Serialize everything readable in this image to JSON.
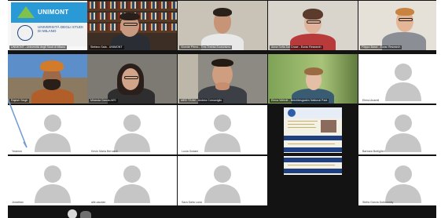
{
  "meeting": {
    "participants": [
      {
        "tile": "logo",
        "name": "UNIMONT - Università degli Studi di Milano"
      },
      {
        "tile": "video",
        "name": "Stefano Sala - UNIMONT"
      },
      {
        "tile": "video",
        "name": "Vicente Pérez - Tres Treinta Ecoturismo"
      },
      {
        "tile": "video",
        "name": "Anna Sofia Dal Croce - Eurac Research"
      },
      {
        "tile": "video",
        "name": "Filippo Bassi - Eurac Research"
      },
      {
        "tile": "video",
        "name": "Rajesh Singh"
      },
      {
        "tile": "video",
        "name": "Miranda Garcia AES"
      },
      {
        "tile": "video",
        "name": "MEB TEAM - Andrea Cornaviglio"
      },
      {
        "tile": "video",
        "name": "Elena Wehrle - Berchtesgaden National Park"
      },
      {
        "tile": "avatar",
        "name": "Elena Anaridi"
      },
      {
        "tile": "avatar",
        "name": "Yeamon"
      },
      {
        "tile": "avatar",
        "name": "Kevin Maria Bernardi"
      },
      {
        "tile": "avatar",
        "name": "Lucia Godani"
      },
      {
        "tile": "avatar",
        "name": "Julian Mentag"
      },
      {
        "tile": "document",
        "name": ""
      },
      {
        "tile": "avatar",
        "name": "Barbara Bottiglieri"
      },
      {
        "tile": "avatar",
        "name": "Jonathan"
      },
      {
        "tile": "avatar",
        "name": "alle.caudan"
      },
      {
        "tile": "avatar",
        "name": "Sara Dalla Lana"
      },
      {
        "tile": "avatar",
        "name": "Daniele Bassanini"
      },
      {
        "tile": "document",
        "name": ""
      },
      {
        "tile": "avatar",
        "name": "Stella Garcia Dubrowsky"
      }
    ]
  },
  "logo": {
    "brand": "UNIMONT",
    "university": "UNIVERSITÀ DEGLI STUDI DI MILANO"
  },
  "colors": {
    "gallery_background": "#131313",
    "avatar_tile": "#ffffff",
    "avatar_silhouette": "#c6c6c6",
    "unimont_blue": "#2a9ad6",
    "unimont_green": "#7fc14b",
    "pointer": "#6d9bd3"
  },
  "icons": {
    "avatar": "person-silhouette-icon",
    "pointer": "pointer-arrow-icon"
  }
}
